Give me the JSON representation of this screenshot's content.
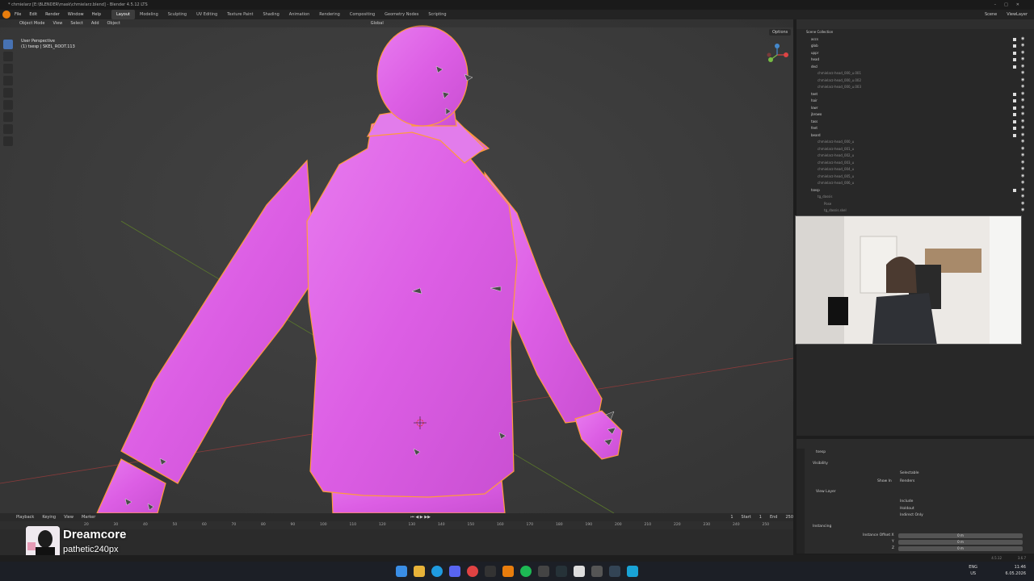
{
  "window": {
    "title": "* chmielarz [E:\\BLENDER\\mask\\chmielarz.blend] - Blender 4.5.12 LTS"
  },
  "menu": [
    "File",
    "Edit",
    "Render",
    "Window",
    "Help"
  ],
  "workspaces": [
    "Layout",
    "Modeling",
    "Sculpting",
    "UV Editing",
    "Texture Paint",
    "Shading",
    "Animation",
    "Rendering",
    "Compositing",
    "Geometry Nodes",
    "Scripting"
  ],
  "active_workspace": "Layout",
  "topbar_right": {
    "scene": "Scene",
    "view_layer": "ViewLayer"
  },
  "viewport": {
    "header": {
      "mode": "Object Mode",
      "items": [
        "View",
        "Select",
        "Add",
        "Object"
      ],
      "orientation": "Global",
      "options": "Options"
    },
    "label_line1": "User Perspective",
    "label_line2": "(1) tsesp | SKEL_ROOT.113"
  },
  "outliner": {
    "search_placeholder": "",
    "root": "Scene Collection",
    "rows": [
      {
        "name": "accs",
        "indent": 1
      },
      {
        "name": "glob",
        "indent": 1
      },
      {
        "name": "uppr",
        "indent": 1
      },
      {
        "name": "head",
        "indent": 1
      },
      {
        "name": "decl",
        "indent": 1
      },
      {
        "name": "chmielarz-head_000_u.001",
        "indent": 2
      },
      {
        "name": "chmielarz-head_000_u.002",
        "indent": 2
      },
      {
        "name": "chmielarz-head_000_u.003",
        "indent": 2
      },
      {
        "name": "teet",
        "indent": 1
      },
      {
        "name": "hair",
        "indent": 1
      },
      {
        "name": "lowr",
        "indent": 1
      },
      {
        "name": "jbrowo",
        "indent": 1
      },
      {
        "name": "tass",
        "indent": 1
      },
      {
        "name": "feet",
        "indent": 1
      },
      {
        "name": "beard",
        "indent": 1
      },
      {
        "name": "chmielarz-head_000_u",
        "indent": 2
      },
      {
        "name": "chmielarz-head_001_u",
        "indent": 2
      },
      {
        "name": "chmielarz-head_002_u",
        "indent": 2
      },
      {
        "name": "chmielarz-head_003_u",
        "indent": 2
      },
      {
        "name": "chmielarz-head_004_u",
        "indent": 2
      },
      {
        "name": "chmielarz-head_005_u",
        "indent": 2
      },
      {
        "name": "chmielarz-head_006_u",
        "indent": 2
      },
      {
        "name": "tsesp",
        "indent": 1
      },
      {
        "name": "tg_dassis",
        "indent": 2
      },
      {
        "name": "Pose",
        "indent": 3
      },
      {
        "name": "tg_dassis.skel",
        "indent": 3
      }
    ]
  },
  "properties": {
    "object_name": "tsesp",
    "sections": {
      "visibility": "Visibility",
      "selectable": "Selectable",
      "show_in": "Show In",
      "renders": "Renders",
      "view_layer": "View Layer",
      "include": "Include",
      "holdout": "Holdout",
      "indirect_only": "Indirect Only",
      "instancing": "Instancing",
      "instance_offset_x": "Instance Offset X",
      "y": "Y",
      "z": "Z",
      "offset_value": "0 m"
    }
  },
  "timeline": {
    "header": [
      "Playback",
      "Keying",
      "View",
      "Marker"
    ],
    "current_frame": "1",
    "start_label": "Start",
    "start": "1",
    "end_label": "End",
    "end": "250",
    "ruler": [
      "20",
      "30",
      "40",
      "50",
      "60",
      "70",
      "80",
      "90",
      "100",
      "110",
      "120",
      "130",
      "140",
      "150",
      "160",
      "170",
      "180",
      "190",
      "200",
      "210",
      "220",
      "230",
      "240",
      "250"
    ]
  },
  "now_playing": {
    "title": "Dreamcore",
    "artist": "pathetic240px"
  },
  "statusbar": {
    "version": "4.5.12",
    "extra": "3.6.7"
  },
  "taskbar": {
    "lang_line1": "ENG",
    "lang_line2": "US",
    "time": "11:46",
    "date": "6.05.2026"
  },
  "colors": {
    "mesh_pink": "#e063e8",
    "selection_outline": "#ff9a3c",
    "viewport_bg": "#3e3e3e",
    "panel_bg": "#282828"
  }
}
